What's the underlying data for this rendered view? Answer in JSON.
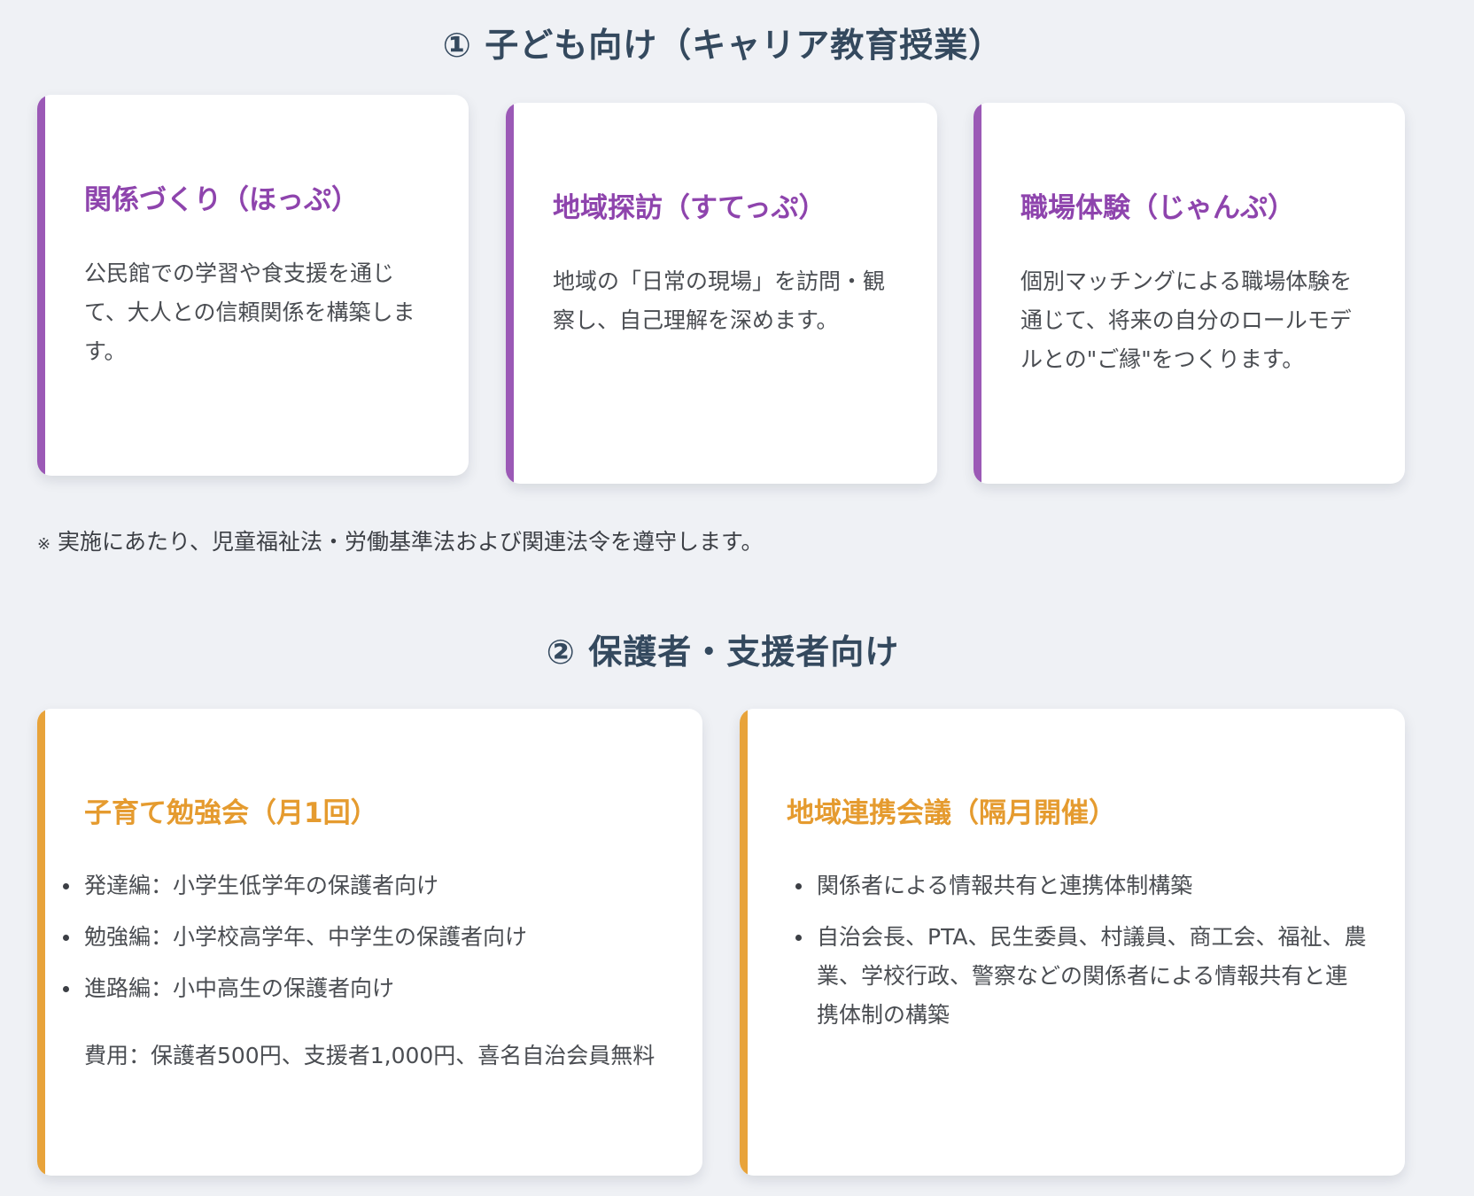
{
  "section1": {
    "title": "① 子ども向け（キャリア教育授業）",
    "cards": [
      {
        "title": "関係づくり（ほっぷ）",
        "text": "公民館での学習や食支援を通じて、大人との信頼関係を構築します。"
      },
      {
        "title": "地域探訪（すてっぷ）",
        "text": "地域の「日常の現場」を訪問・観察し、自己理解を深めます。"
      },
      {
        "title": "職場体験（じゃんぷ）",
        "text": "個別マッチングによる職場体験を通じて、将来の自分のロールモデルとの\"ご縁\"をつくります。"
      }
    ],
    "note_mark": "※",
    "note": " 実施にあたり、児童福祉法・労働基準法および関連法令を遵守します。"
  },
  "section2": {
    "title": "② 保護者・支援者向け",
    "cards": [
      {
        "title": "子育て勉強会（月1回）",
        "items": [
          "発達編：小学生低学年の保護者向け",
          "勉強編：小学校高学年、中学生の保護者向け",
          "進路編：小中高生の保護者向け"
        ],
        "cost": "費用：保護者500円、支援者1,000円、喜名自治会員無料"
      },
      {
        "title": "地域連携会議（隔月開催）",
        "items": [
          "関係者による情報共有と連携体制構築",
          "自治会長、PTA、民生委員、村議員、商工会、福祉、農業、学校行政、警察などの関係者による情報共有と連携体制の構築"
        ]
      }
    ]
  },
  "colors": {
    "accent_purple": "#8e44ad",
    "accent_orange": "#e59b2f",
    "heading": "#34495e",
    "background": "#eff1f5"
  }
}
